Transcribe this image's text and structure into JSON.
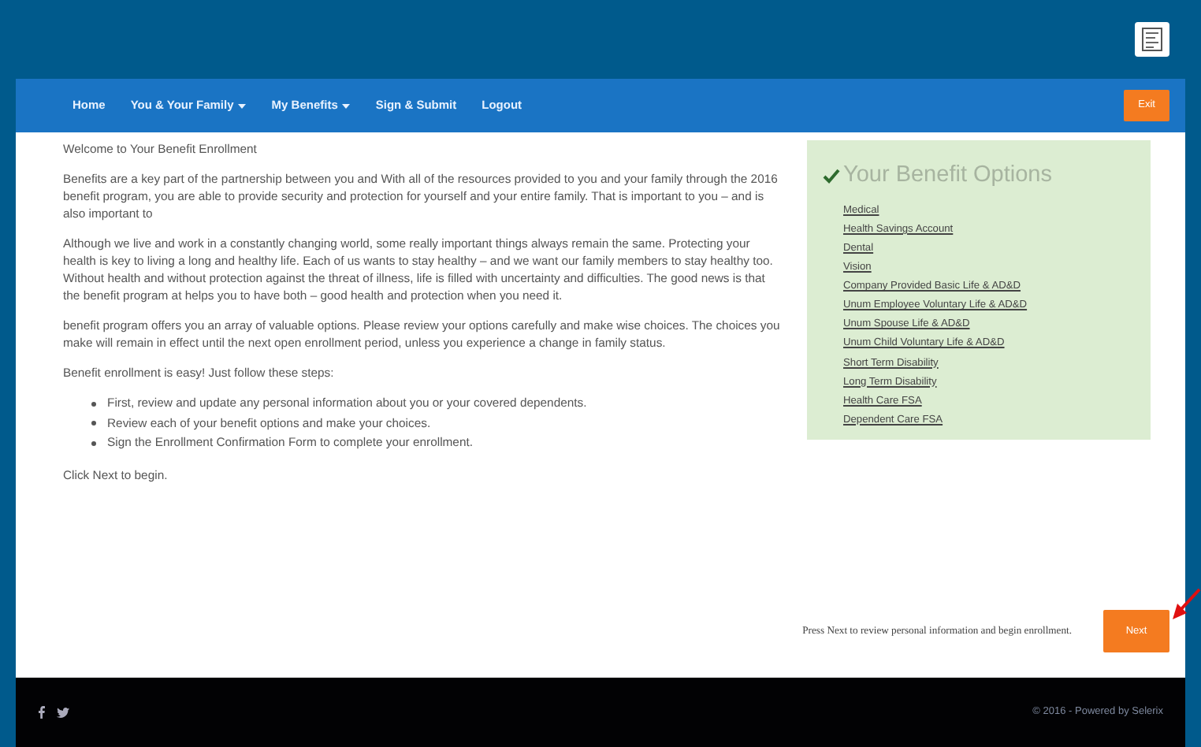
{
  "nav": {
    "items": [
      {
        "label": "Home",
        "dropdown": false
      },
      {
        "label": "You & Your Family",
        "dropdown": true
      },
      {
        "label": "My Benefits",
        "dropdown": true
      },
      {
        "label": "Sign & Submit",
        "dropdown": false
      },
      {
        "label": "Logout",
        "dropdown": false
      }
    ],
    "exit_button": "Exit"
  },
  "content": {
    "title": "Welcome to Your Benefit Enrollment",
    "paragraphs": [
      "Benefits are a key part of the partnership between you and With all of the resources provided to you and your family through the 2016 benefit program, you are able to provide security and protection for yourself and your entire family. That is important to you – and is also important to",
      "Although we live and work in a constantly changing world, some really important things always remain the same. Protecting your health is key to living a long and healthy life. Each of us wants to stay healthy – and we want our family members to stay healthy too. Without health and without protection against the threat of illness, life is filled with uncertainty and difficulties. The good news is that the benefit program at helps you to have both – good health and protection when you need it.",
      "benefit program offers you an array of valuable options. Please review your options carefully and make wise choices. The choices you make will remain in effect until the next open enrollment period, unless you experience a change in family status.",
      "Benefit enrollment is easy! Just follow these steps:"
    ],
    "steps": [
      "First, review and update any personal information about you or your covered dependents.",
      "Review each of your benefit options and make your choices.",
      "Sign the Enrollment Confirmation Form to complete your enrollment."
    ],
    "closing": "Click Next to begin."
  },
  "options": {
    "title": "Your Benefit Options",
    "links": [
      "Medical",
      "Health Savings Account",
      "Dental",
      "Vision",
      "Company Provided Basic Life & AD&D",
      "Unum Employee Voluntary Life & AD&D",
      "Unum Spouse Life & AD&D",
      "Unum Child Voluntary Life & AD&D",
      "Short Term Disability",
      "Long Term Disability",
      "Health Care FSA",
      "Dependent Care FSA"
    ]
  },
  "action_bar": {
    "hint": "Press Next to review personal information and begin enrollment.",
    "next_button": "Next"
  },
  "footer": {
    "copyright": "© 2016 - Powered by Selerix"
  }
}
